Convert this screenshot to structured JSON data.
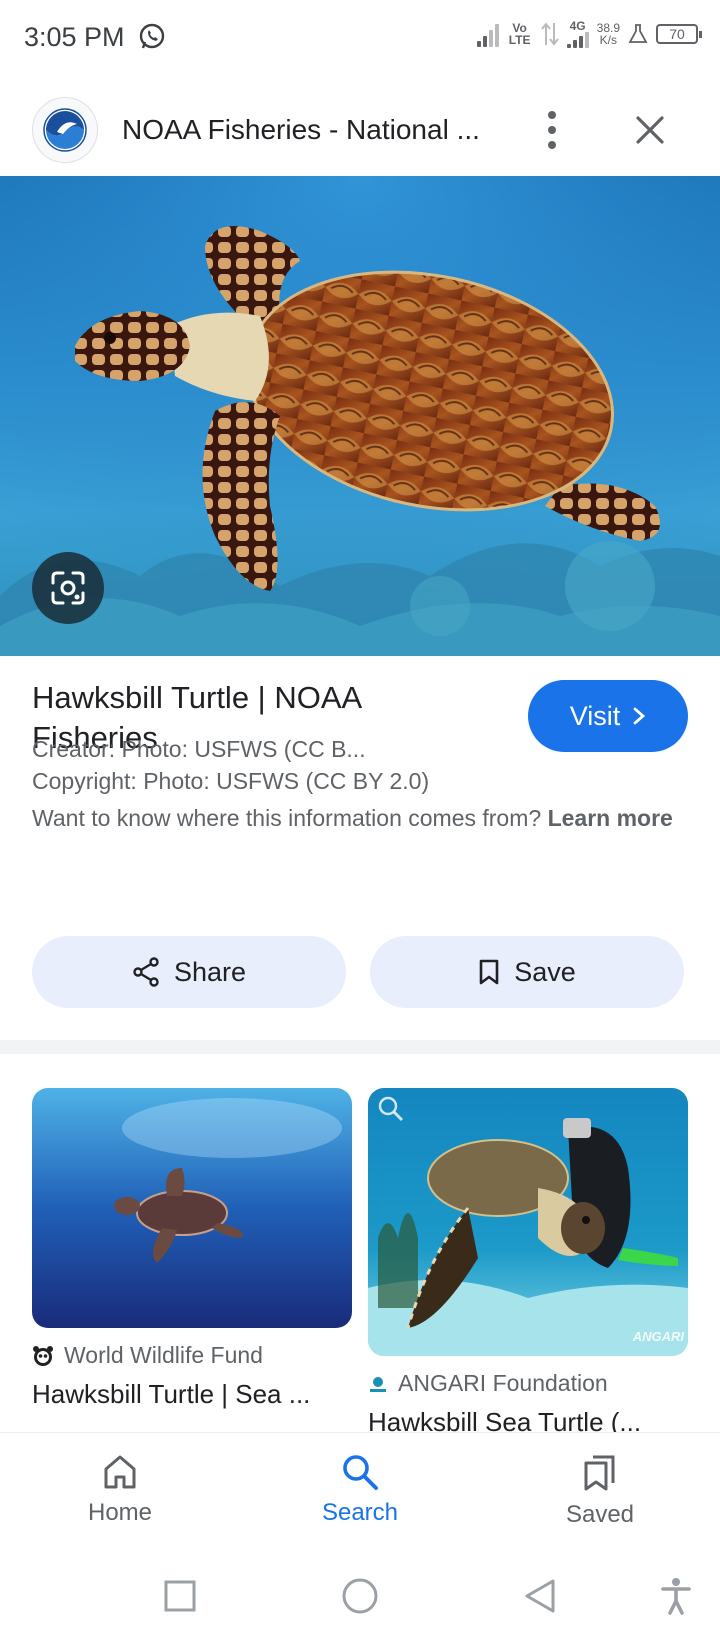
{
  "status_bar": {
    "time": "3:05 PM",
    "volte": "Vo LTE",
    "network": "4G",
    "speed": "38.9",
    "speed_unit": "K/s",
    "battery": "70"
  },
  "header": {
    "site_title": "NOAA Fisheries - National ...",
    "favicon": "noaa-logo-icon"
  },
  "result": {
    "title": "Hawksbill Turtle | NOAA Fisheries",
    "visit_label": "Visit",
    "creator": "Creator: Photo: USFWS (CC B...",
    "copyright": "Copyright: Photo: USFWS (CC BY 2.0)",
    "learn_prefix": "Want to know where this information comes from?",
    "learn_link": "Learn more",
    "share_label": "Share",
    "save_label": "Save"
  },
  "related": [
    {
      "source": "World Wildlife Fund",
      "title": "Hawksbill Turtle | Sea ..."
    },
    {
      "source": "ANGARI Foundation",
      "title": "Hawksbill Sea Turtle (...",
      "watermark": "ANGARI"
    }
  ],
  "nav": {
    "home": "Home",
    "search": "Search",
    "saved": "Saved"
  },
  "colors": {
    "accent": "#1a73e8",
    "pill_bg": "#e8eefb"
  }
}
